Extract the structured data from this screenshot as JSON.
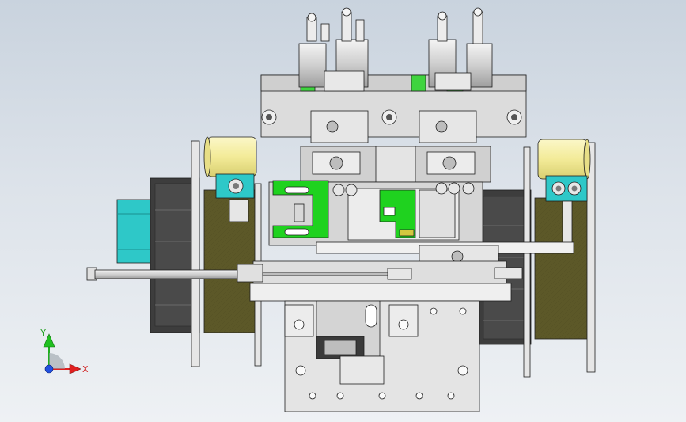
{
  "triad": {
    "x_label": "X",
    "y_label": "Y"
  },
  "colors": {
    "background_top": "#c9d3de",
    "background_bottom": "#eef1f4",
    "metal": "#d8d8d8",
    "metal_light": "#ededed",
    "metal_dark": "#9a9a9a",
    "olive": "#5f5a2a",
    "dark_panel": "#3a3a3a",
    "green": "#1fd21f",
    "cyan": "#29c6c6",
    "yellow": "#f5efa3",
    "axis_x": "#e02020",
    "axis_y": "#20b020",
    "axis_z": "#2050e0"
  }
}
